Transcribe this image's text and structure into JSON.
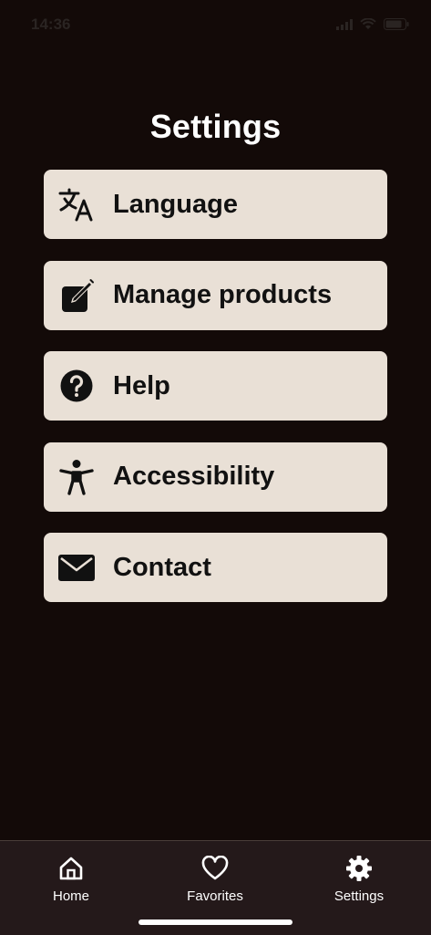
{
  "status_bar": {
    "time": "14:36",
    "icons": [
      "signal-icon",
      "wifi-icon",
      "battery-icon"
    ]
  },
  "page": {
    "title": "Settings"
  },
  "menu": {
    "items": [
      {
        "label": "Language",
        "icon": "translate-icon"
      },
      {
        "label": "Manage products",
        "icon": "edit-icon"
      },
      {
        "label": "Help",
        "icon": "help-icon"
      },
      {
        "label": "Accessibility",
        "icon": "accessibility-icon"
      },
      {
        "label": "Contact",
        "icon": "mail-icon"
      }
    ]
  },
  "tab_bar": {
    "tabs": [
      {
        "label": "Home",
        "icon": "home-icon"
      },
      {
        "label": "Favorites",
        "icon": "heart-icon"
      },
      {
        "label": "Settings",
        "icon": "gear-icon"
      }
    ]
  },
  "colors": {
    "background": "#130a08",
    "card": "#e9e0d6",
    "tab_bar": "#24191a",
    "text_light": "#ffffff",
    "text_dark": "#111111"
  }
}
